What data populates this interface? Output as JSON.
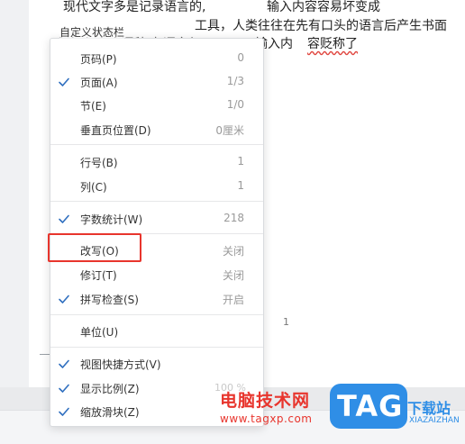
{
  "document": {
    "line1_left": "现代文字多是记录语言的,",
    "line1_right": "输入内容容易坏变成",
    "line2": "工具，人类往往在先有口头的语言后产生书面",
    "line3_faint": "文字   但多小语种   有语言但",
    "line3_right": "输入内",
    "line3_underlined": "容贬称了",
    "page_number": "1"
  },
  "menu": {
    "title": "自定义状态栏",
    "items": [
      {
        "label": "页码(P)",
        "value": "0",
        "checked": false
      },
      {
        "label": "页面(A)",
        "value": "1/3",
        "checked": true
      },
      {
        "label": "节(E)",
        "value": "1/0",
        "checked": false
      },
      {
        "label": "垂直页位置(D)",
        "value": "0厘米",
        "checked": false
      },
      {
        "label": "行号(B)",
        "value": "1",
        "checked": false
      },
      {
        "label": "列(C)",
        "value": "1",
        "checked": false
      },
      {
        "label": "字数统计(W)",
        "value": "218",
        "checked": true
      },
      {
        "label": "改写(O)",
        "value": "关闭",
        "checked": false
      },
      {
        "label": "修订(T)",
        "value": "关闭",
        "checked": false
      },
      {
        "label": "拼写检查(S)",
        "value": "开启",
        "checked": true
      },
      {
        "label": "单位(U)",
        "value": "",
        "checked": false
      },
      {
        "label": "视图快捷方式(V)",
        "value": "",
        "checked": true
      },
      {
        "label": "显示比例(Z)",
        "value": "",
        "checked": true
      },
      {
        "label": "缩放滑块(Z)",
        "value": "",
        "checked": true
      }
    ],
    "faint_value": "100 %"
  },
  "watermark": {
    "cn_text": "电脑技术网",
    "url": "www.tagxp.com",
    "logo": "TAG",
    "side_text": "下载站",
    "side_small": "XIAZAIZHAN"
  },
  "colors": {
    "accent_check": "#2f6fbf",
    "highlight": "#e8352d",
    "logo_blue": "#2f8ee6"
  }
}
